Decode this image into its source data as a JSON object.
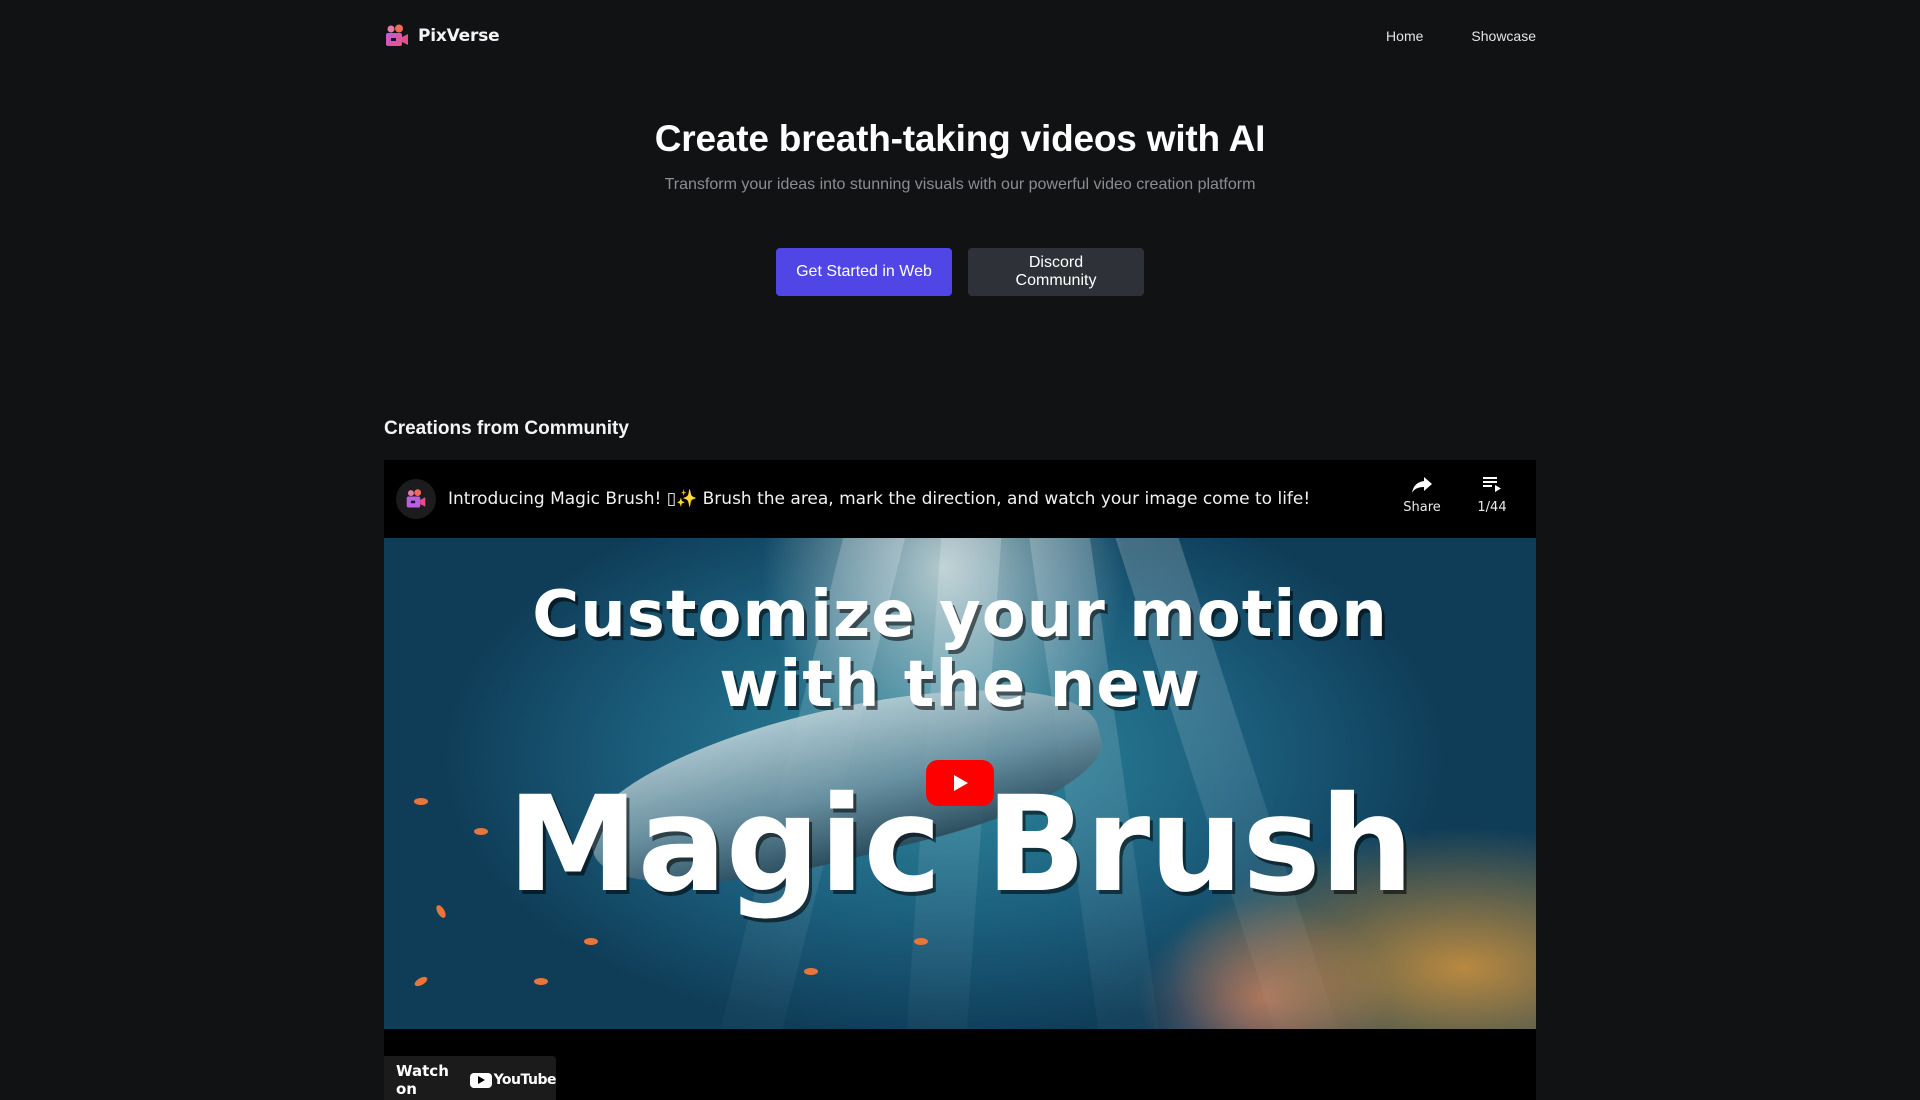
{
  "nav": {
    "brand": "PixVerse",
    "logo_icon": "video-camera-icon",
    "links": [
      {
        "label": "Home"
      },
      {
        "label": "Showcase"
      }
    ]
  },
  "hero": {
    "title": "Create breath-taking videos with AI",
    "subtitle": "Transform your ideas into stunning visuals with our powerful video creation platform"
  },
  "cta": {
    "primary_label": "Get Started in Web",
    "secondary_label": "Discord Community",
    "primary_color": "#4f46e5",
    "secondary_color": "#2e3238"
  },
  "community": {
    "section_title": "Creations from Community",
    "video": {
      "title_part1": "Introducing Magic Brush! ▯",
      "title_sparkle": "✨",
      "title_part2": " Brush the area, mark the direction, and watch your image come to life!",
      "share_label": "Share",
      "playlist_position": "1/44",
      "thumbnail_text_line1": "Customize your motion",
      "thumbnail_text_line2": "with the new",
      "thumbnail_text_line3": "Magic Brush",
      "watch_on_label": "Watch on",
      "youtube_label": "YouTube",
      "play_button_color": "#ff0000"
    }
  }
}
